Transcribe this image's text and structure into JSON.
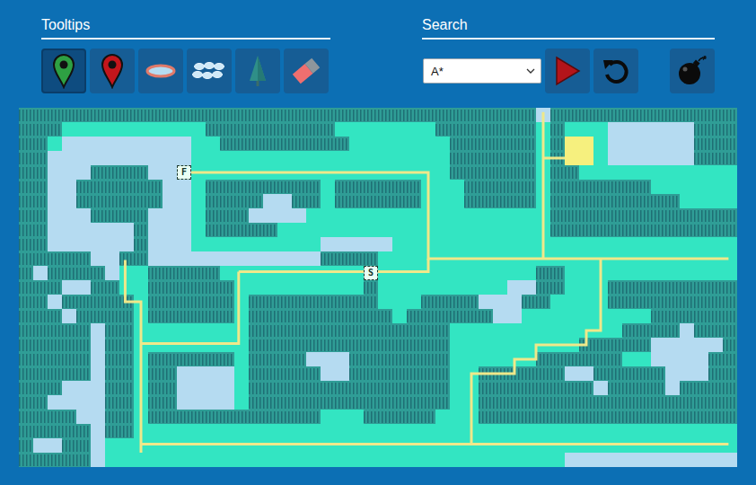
{
  "tooltips": {
    "title": "Tooltips",
    "tools": [
      {
        "kind": "start",
        "selected": true
      },
      {
        "kind": "finish",
        "selected": false
      },
      {
        "kind": "lake",
        "selected": false
      },
      {
        "kind": "water",
        "selected": false
      },
      {
        "kind": "forest",
        "selected": false
      },
      {
        "kind": "eraser",
        "selected": false
      }
    ]
  },
  "search": {
    "title": "Search",
    "algorithm": "A*",
    "buttons": [
      {
        "kind": "play"
      },
      {
        "kind": "undo"
      },
      {
        "kind": "bomb"
      }
    ]
  },
  "map": {
    "cols": 50,
    "rows": [
      [
        [
          "T",
          36
        ],
        [
          "w",
          1
        ],
        [
          "T",
          13
        ]
      ],
      [
        [
          "T",
          3
        ],
        [
          ".",
          10
        ],
        [
          "T",
          9
        ],
        [
          ".",
          7
        ],
        [
          "T",
          7
        ],
        [
          ".",
          1
        ],
        [
          "T",
          1
        ],
        [
          ".",
          3
        ],
        [
          "w",
          6
        ],
        [
          "T",
          3
        ]
      ],
      [
        [
          "T",
          2
        ],
        [
          ".",
          1
        ],
        [
          "w",
          9
        ],
        [
          ".",
          2
        ],
        [
          "T",
          9
        ],
        [
          ".",
          7
        ],
        [
          "T",
          6
        ],
        [
          ".",
          1
        ],
        [
          "T",
          1
        ],
        [
          "y",
          2
        ],
        [
          ".",
          1
        ],
        [
          "w",
          6
        ],
        [
          "T",
          3
        ]
      ],
      [
        [
          "T",
          2
        ],
        [
          "w",
          10
        ],
        [
          ".",
          18
        ],
        [
          "T",
          6
        ],
        [
          ".",
          1
        ],
        [
          "T",
          1
        ],
        [
          "y",
          2
        ],
        [
          ".",
          1
        ],
        [
          "w",
          6
        ],
        [
          "T",
          3
        ]
      ],
      [
        [
          "T",
          2
        ],
        [
          "w",
          3
        ],
        [
          "T",
          4
        ],
        [
          "w",
          3
        ],
        [
          ".",
          18
        ],
        [
          "T",
          6
        ],
        [
          ".",
          1
        ],
        [
          "T",
          2
        ],
        [
          ".",
          11
        ]
      ],
      [
        [
          "T",
          2
        ],
        [
          "w",
          2
        ],
        [
          "T",
          6
        ],
        [
          "w",
          2
        ],
        [
          ".",
          1
        ],
        [
          "T",
          8
        ],
        [
          ".",
          1
        ],
        [
          "T",
          6
        ],
        [
          ".",
          3
        ],
        [
          "T",
          5
        ],
        [
          ".",
          1
        ],
        [
          "T",
          7
        ],
        [
          ".",
          6
        ]
      ],
      [
        [
          "T",
          2
        ],
        [
          "w",
          2
        ],
        [
          "T",
          6
        ],
        [
          "w",
          2
        ],
        [
          ".",
          1
        ],
        [
          "T",
          4
        ],
        [
          "w",
          2
        ],
        [
          "T",
          2
        ],
        [
          ".",
          1
        ],
        [
          "T",
          6
        ],
        [
          ".",
          3
        ],
        [
          "T",
          5
        ],
        [
          ".",
          1
        ],
        [
          "T",
          9
        ],
        [
          ".",
          4
        ]
      ],
      [
        [
          "T",
          2
        ],
        [
          "w",
          3
        ],
        [
          "T",
          4
        ],
        [
          "w",
          3
        ],
        [
          ".",
          1
        ],
        [
          "T",
          3
        ],
        [
          "w",
          4
        ],
        [
          ".",
          16
        ],
        [
          ".",
          1
        ],
        [
          "T",
          13
        ]
      ],
      [
        [
          "T",
          2
        ],
        [
          "w",
          6
        ],
        [
          "T",
          1
        ],
        [
          "w",
          3
        ],
        [
          ".",
          1
        ],
        [
          "T",
          5
        ],
        [
          ".",
          19
        ],
        [
          "T",
          13
        ]
      ],
      [
        [
          "T",
          2
        ],
        [
          "w",
          6
        ],
        [
          "T",
          1
        ],
        [
          "w",
          3
        ],
        [
          ".",
          9
        ],
        [
          "w",
          5
        ],
        [
          ".",
          24
        ]
      ],
      [
        [
          "T",
          2
        ],
        [
          "T",
          3
        ],
        [
          "w",
          2
        ],
        [
          "T",
          2
        ],
        [
          "w",
          12
        ],
        [
          "T",
          4
        ],
        [
          ".",
          25
        ]
      ],
      [
        [
          "T",
          1
        ],
        [
          "w",
          1
        ],
        [
          "T",
          4
        ],
        [
          "w",
          1
        ],
        [
          ".",
          2
        ],
        [
          "T",
          5
        ],
        [
          ".",
          22
        ],
        [
          "T",
          2
        ],
        [
          ".",
          12
        ]
      ],
      [
        [
          "T",
          3
        ],
        [
          "w",
          2
        ],
        [
          "T",
          2
        ],
        [
          ".",
          2
        ],
        [
          "T",
          6
        ],
        [
          ".",
          1
        ],
        [
          ".",
          8
        ],
        [
          "T",
          1
        ],
        [
          ".",
          9
        ],
        [
          "w",
          2
        ],
        [
          "T",
          2
        ],
        [
          ".",
          3
        ],
        [
          "T",
          9
        ]
      ],
      [
        [
          "T",
          2
        ],
        [
          "w",
          1
        ],
        [
          "T",
          5
        ],
        [
          ".",
          1
        ],
        [
          "T",
          6
        ],
        [
          ".",
          1
        ],
        [
          "T",
          9
        ],
        [
          ".",
          3
        ],
        [
          "T",
          4
        ],
        [
          "w",
          3
        ],
        [
          "T",
          2
        ],
        [
          ".",
          4
        ],
        [
          "T",
          9
        ]
      ],
      [
        [
          "T",
          3
        ],
        [
          "w",
          1
        ],
        [
          "T",
          4
        ],
        [
          ".",
          1
        ],
        [
          "T",
          6
        ],
        [
          ".",
          1
        ],
        [
          "T",
          10
        ],
        [
          ".",
          1
        ],
        [
          "T",
          6
        ],
        [
          "w",
          2
        ],
        [
          ".",
          9
        ],
        [
          "T",
          6
        ]
      ],
      [
        [
          "T",
          5
        ],
        [
          "w",
          1
        ],
        [
          "T",
          2
        ],
        [
          ".",
          1
        ],
        [
          ".",
          6
        ],
        [
          ".",
          1
        ],
        [
          "T",
          14
        ],
        [
          ".",
          12
        ],
        [
          "T",
          4
        ],
        [
          "w",
          1
        ],
        [
          "T",
          3
        ]
      ],
      [
        [
          "T",
          5
        ],
        [
          "w",
          1
        ],
        [
          "T",
          2
        ],
        [
          ".",
          8
        ],
        [
          "T",
          14
        ],
        [
          ".",
          9
        ],
        [
          "T",
          5
        ],
        [
          "w",
          5
        ],
        [
          "T",
          1
        ]
      ],
      [
        [
          "T",
          5
        ],
        [
          "w",
          1
        ],
        [
          "T",
          2
        ],
        [
          ".",
          1
        ],
        [
          "T",
          6
        ],
        [
          ".",
          1
        ],
        [
          "T",
          4
        ],
        [
          "w",
          3
        ],
        [
          "T",
          7
        ],
        [
          ".",
          6
        ],
        [
          "T",
          6
        ],
        [
          ".",
          2
        ],
        [
          "w",
          4
        ],
        [
          "T",
          2
        ]
      ],
      [
        [
          "T",
          5
        ],
        [
          "w",
          1
        ],
        [
          "T",
          2
        ],
        [
          ".",
          1
        ],
        [
          "T",
          2
        ],
        [
          "w",
          4
        ],
        [
          ".",
          1
        ],
        [
          "T",
          5
        ],
        [
          "w",
          2
        ],
        [
          "T",
          7
        ],
        [
          ".",
          2
        ],
        [
          "T",
          6
        ],
        [
          "w",
          2
        ],
        [
          "T",
          5
        ],
        [
          "w",
          3
        ],
        [
          "T",
          2
        ]
      ],
      [
        [
          "T",
          3
        ],
        [
          "w",
          3
        ],
        [
          "T",
          2
        ],
        [
          ".",
          1
        ],
        [
          "T",
          2
        ],
        [
          "w",
          4
        ],
        [
          ".",
          1
        ],
        [
          "T",
          14
        ],
        [
          ".",
          2
        ],
        [
          "T",
          8
        ],
        [
          "w",
          1
        ],
        [
          "T",
          4
        ],
        [
          "w",
          1
        ],
        [
          "T",
          4
        ]
      ],
      [
        [
          "T",
          2
        ],
        [
          "w",
          4
        ],
        [
          "T",
          2
        ],
        [
          ".",
          1
        ],
        [
          "T",
          2
        ],
        [
          "w",
          4
        ],
        [
          ".",
          1
        ],
        [
          "T",
          14
        ],
        [
          ".",
          2
        ],
        [
          "T",
          18
        ]
      ],
      [
        [
          "T",
          4
        ],
        [
          "w",
          2
        ],
        [
          "T",
          2
        ],
        [
          ".",
          1
        ],
        [
          "T",
          12
        ],
        [
          ".",
          3
        ],
        [
          "T",
          5
        ],
        [
          ".",
          3
        ],
        [
          "T",
          18
        ]
      ],
      [
        [
          "T",
          5
        ],
        [
          "w",
          1
        ],
        [
          "T",
          2
        ],
        [
          ".",
          42
        ]
      ],
      [
        [
          "T",
          1
        ],
        [
          "w",
          2
        ],
        [
          "T",
          2
        ],
        [
          "w",
          1
        ],
        [
          ".",
          44
        ]
      ],
      [
        [
          "T",
          5
        ],
        [
          "w",
          1
        ],
        [
          ".",
          32
        ],
        [
          "w",
          12
        ]
      ]
    ],
    "paths": [
      [
        [
          11.5,
          4.5
        ],
        [
          28.5,
          4.5
        ],
        [
          28.5,
          10.5
        ],
        [
          49.4,
          10.5
        ]
      ],
      [
        [
          15.3,
          11.4
        ],
        [
          28.5,
          11.4
        ],
        [
          28.5,
          10.5
        ]
      ],
      [
        [
          15.3,
          11.4
        ],
        [
          15.3,
          16.4
        ],
        [
          8.5,
          16.4
        ]
      ],
      [
        [
          7.4,
          10.6
        ],
        [
          7.4,
          13.5
        ],
        [
          8.5,
          13.5
        ],
        [
          8.5,
          24
        ]
      ],
      [
        [
          8.5,
          23.4
        ],
        [
          49.4,
          23.4
        ]
      ],
      [
        [
          36.5,
          0.3
        ],
        [
          36.5,
          10.5
        ]
      ],
      [
        [
          36.5,
          3.5
        ],
        [
          38,
          3.5
        ]
      ],
      [
        [
          40.5,
          10.5
        ],
        [
          40.5,
          15.5
        ],
        [
          39.5,
          15.5
        ],
        [
          39.5,
          16.5
        ],
        [
          36,
          16.5
        ],
        [
          36,
          17.5
        ],
        [
          34.5,
          17.5
        ],
        [
          34.5,
          18.5
        ],
        [
          31.5,
          18.5
        ],
        [
          31.5,
          23.4
        ]
      ]
    ],
    "markers": [
      {
        "label": "F",
        "col": 11,
        "row": 4
      },
      {
        "label": "S",
        "col": 24,
        "row": 11
      }
    ]
  }
}
